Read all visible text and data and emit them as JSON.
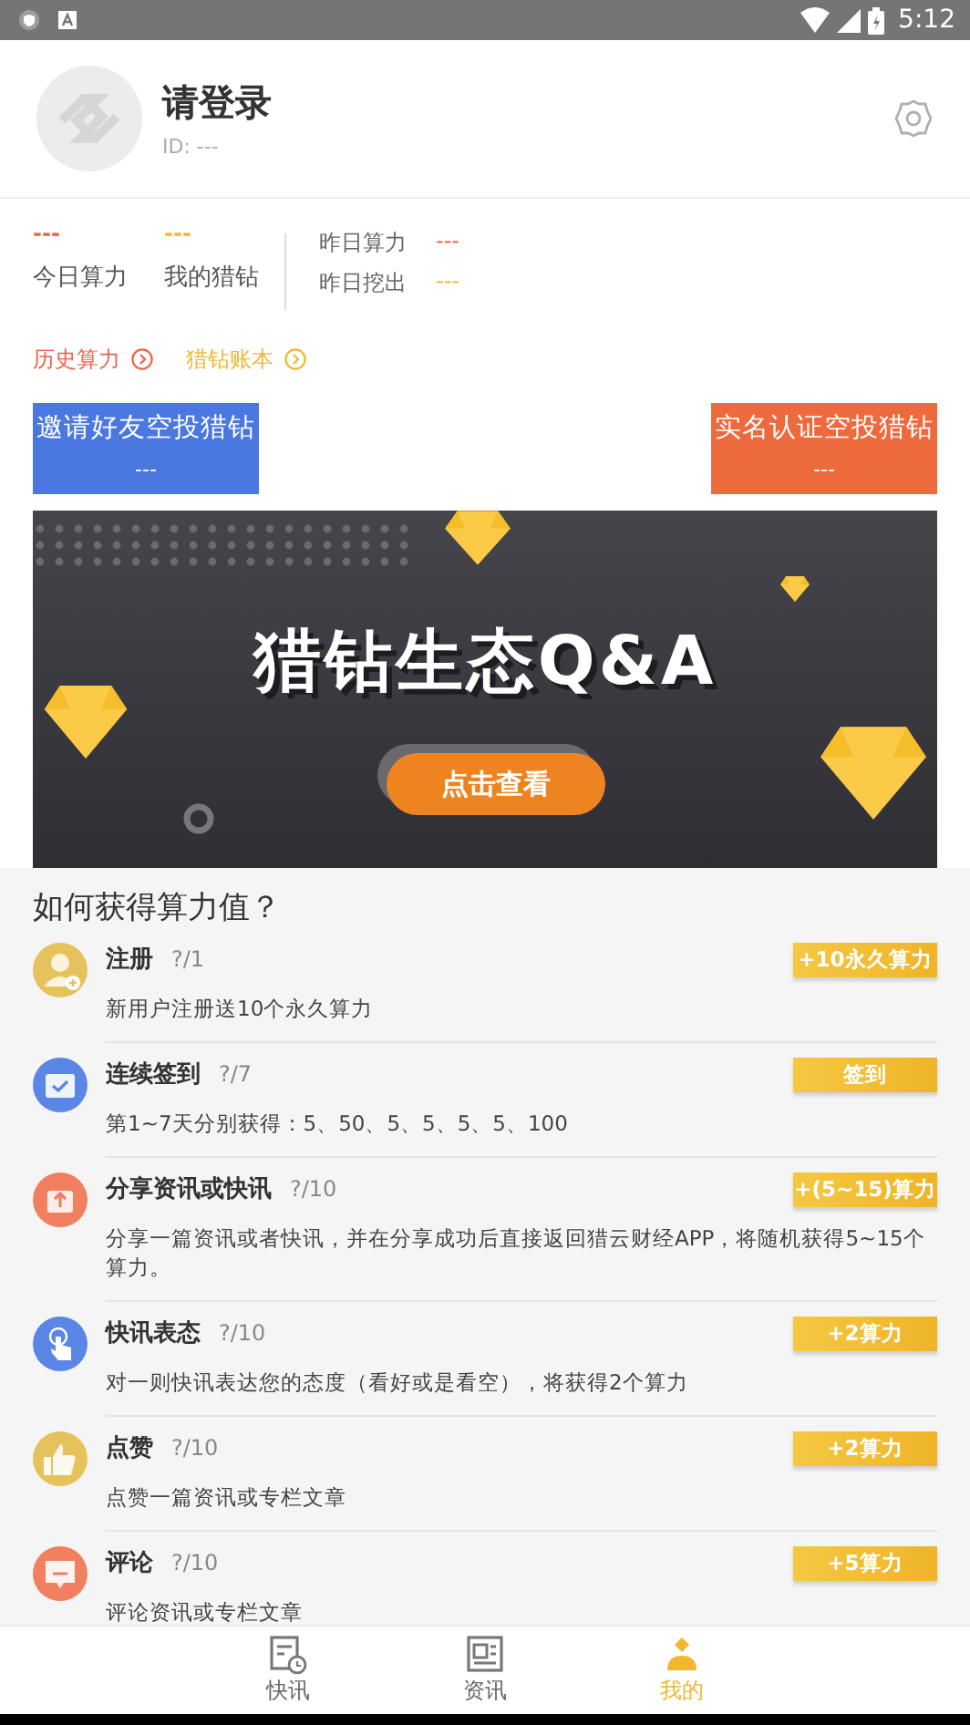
{
  "status_bar": {
    "time": "5:12"
  },
  "profile": {
    "name": "请登录",
    "id": "ID: ---"
  },
  "stats": [
    {
      "value": "---",
      "label": "今日算力",
      "color": "#f0604a"
    },
    {
      "value": "---",
      "label": "我的猎钻",
      "color": "#f2b630"
    }
  ],
  "yesterday": [
    {
      "label": "昨日算力",
      "value": "---",
      "color": "#f0604a"
    },
    {
      "label": "昨日挖出",
      "value": "---",
      "color": "#f2b630"
    }
  ],
  "links": [
    {
      "label": "历史算力",
      "color": "#f0604a"
    },
    {
      "label": "猎钻账本",
      "color": "#f2b630"
    }
  ],
  "promos": [
    {
      "title": "邀请好友空投猎钻",
      "value": "---",
      "color": "#4a78e0"
    },
    {
      "title": "实名认证空投猎钻",
      "value": "---",
      "color": "#ec6a3c"
    }
  ],
  "banner": {
    "title": "猎钻生态Q&A",
    "button": "点击查看"
  },
  "section_title": "如何获得算力值？",
  "tasks": [
    {
      "name": "注册",
      "count": "?/1",
      "reward": "+10永久算力",
      "desc": "新用户注册送10个永久算力"
    },
    {
      "name": "连续签到",
      "count": "?/7",
      "reward": "签到",
      "desc": "第1~7天分别获得：5、50、5、5、5、5、100"
    },
    {
      "name": "分享资讯或快讯",
      "count": "?/10",
      "reward": "+(5~15)算力",
      "desc": "分享一篇资讯或者快讯，并在分享成功后直接返回猎云财经APP，将随机获得5~15个算力。"
    },
    {
      "name": "快讯表态",
      "count": "?/10",
      "reward": "+2算力",
      "desc": "对一则快讯表达您的态度（看好或是看空），将获得2个算力"
    },
    {
      "name": "点赞",
      "count": "?/10",
      "reward": "+2算力",
      "desc": "点赞一篇资讯或专栏文章"
    },
    {
      "name": "评论",
      "count": "?/10",
      "reward": "+5算力",
      "desc": "评论资讯或专栏文章"
    }
  ],
  "tabs": [
    {
      "label": "快讯",
      "selected": false
    },
    {
      "label": "资讯",
      "selected": false
    },
    {
      "label": "我的",
      "selected": true
    }
  ]
}
